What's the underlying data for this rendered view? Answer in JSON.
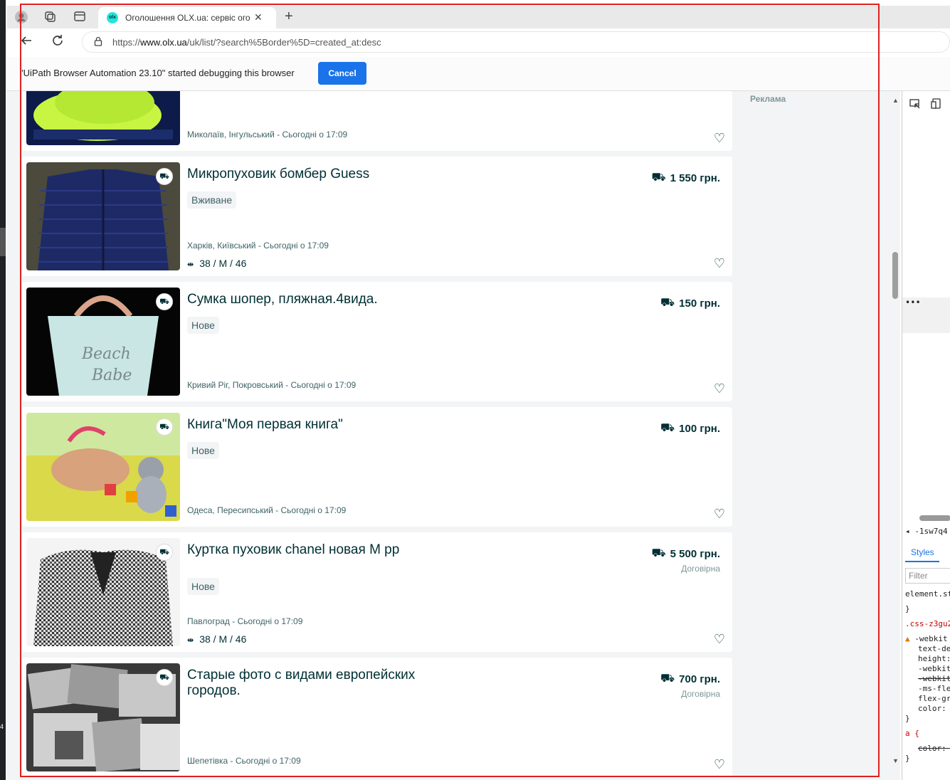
{
  "browser": {
    "tab_title": "Оголошення OLX.ua: сервіс ого",
    "tab_favicon": "olx",
    "url_prefix": "https://",
    "url_domain": "www.olx.ua",
    "url_path": "/uk/list/?search%5Border%5D=created_at:desc"
  },
  "infobar": {
    "message": "\"UiPath Browser Automation 23.10\" started debugging this browser",
    "cancel_label": "Cancel"
  },
  "sidebar": {
    "ad_label": "Реклама"
  },
  "listings": [
    {
      "title": "",
      "condition": "",
      "price": "",
      "negotiable": "",
      "location": "Миколаїв, Інгульський - Сьогодні о 17:09",
      "size": ""
    },
    {
      "title": "Микропуховик бомбер Guess",
      "condition": "Вживане",
      "price": "1 550 грн.",
      "negotiable": "",
      "location": "Харків, Київський - Сьогодні о 17:09",
      "size": "38 / M / 46"
    },
    {
      "title": "Сумка шопер, пляжная.4вида.",
      "condition": "Нове",
      "price": "150 грн.",
      "negotiable": "",
      "location": "Кривий Ріг, Покровський - Сьогодні о 17:09",
      "size": ""
    },
    {
      "title": "Книга\"Моя первая книга\"",
      "condition": "Нове",
      "price": "100 грн.",
      "negotiable": "",
      "location": "Одеса, Пересипський - Сьогодні о 17:09",
      "size": ""
    },
    {
      "title": "Куртка пуховик chanel новая M рр",
      "condition": "Нове",
      "price": "5 500 грн.",
      "negotiable": "Договірна",
      "location": "Павлоград - Сьогодні о 17:09",
      "size": "38 / M / 46"
    },
    {
      "title": "Старые фото с видами европейских городов.",
      "condition": "",
      "price": "700 грн.",
      "negotiable": "Договірна",
      "location": "Шепетівка - Сьогодні о 17:09",
      "size": ""
    }
  ],
  "devtools": {
    "tab_styles": "Styles",
    "filter_placeholder": "Filter",
    "crumb": "-1sw7q4",
    "lines": [
      "element.st",
      "}",
      ".css-z3gu2",
      "-webkit",
      "text-de",
      "height:",
      "-webkit",
      "-webkit",
      "-ms-fle",
      "flex-gr",
      "color:",
      "}",
      "a {",
      "color: -",
      "}"
    ]
  },
  "colors": {
    "olx_dark": "#002f34",
    "olx_cyan": "#23e5db",
    "page_bg": "#f2f4f5",
    "cancel_blue": "#1a73e8",
    "selection_red": "#e02020"
  }
}
